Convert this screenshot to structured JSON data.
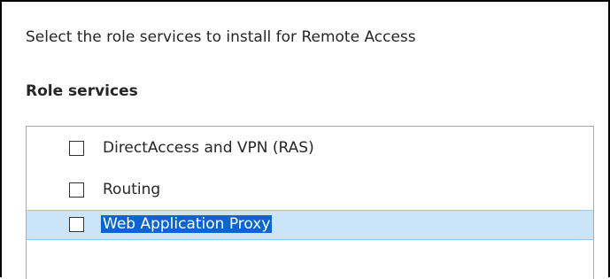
{
  "page": {
    "instruction": "Select the role services to install for Remote Access",
    "section_title": "Role services"
  },
  "role_services": {
    "items": [
      {
        "label": "DirectAccess and VPN (RAS)",
        "checked": false,
        "selected": false
      },
      {
        "label": "Routing",
        "checked": false,
        "selected": false
      },
      {
        "label": "Web Application Proxy",
        "checked": false,
        "selected": true
      }
    ]
  },
  "colors": {
    "selection_background": "#cce4f7",
    "selection_border": "#99c9ef",
    "text_highlight": "#0a64d2",
    "tree_border": "#ababab"
  }
}
